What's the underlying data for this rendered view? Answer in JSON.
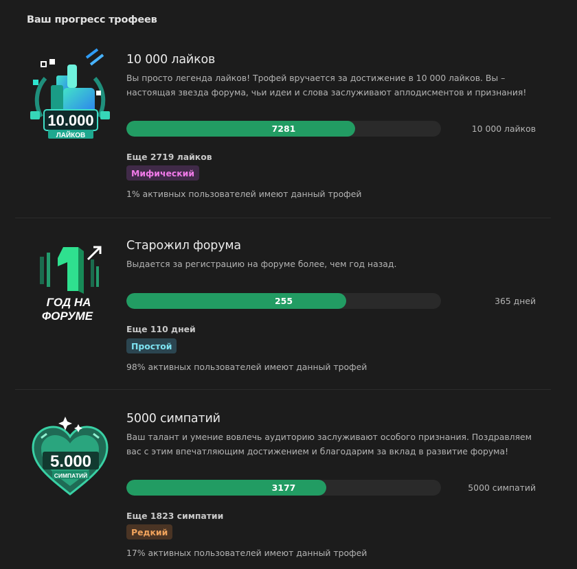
{
  "panel": {
    "title": "Ваш прогресс трофеев"
  },
  "trophies": [
    {
      "name": "10 000 лайков",
      "description": "Вы просто легенда лайков! Трофей вручается за достижение в 10 000 лайков. Вы – настоящая звезда форума, чьи идеи и слова заслуживают аплодисментов и признания!",
      "badge_big": "10.000",
      "badge_small": "ЛАЙКОВ",
      "icon": "thumbs-up-trophy-icon",
      "progress_value": "7281",
      "progress_fraction": 0.7281,
      "goal": "10 000 лайков",
      "remaining": "Еще 2719 лайков",
      "rarity": "Мифический",
      "share": "1% активных пользователей имеют данный трофей"
    },
    {
      "name": "Старожил форума",
      "description": "Выдается за регистрацию на форуме более, чем год назад.",
      "badge_big": "1",
      "badge_line1": "ГОД НА",
      "badge_line2": "ФОРУМЕ",
      "icon": "one-year-trophy-icon",
      "progress_value": "255",
      "progress_fraction": 0.6986,
      "goal": "365 дней",
      "remaining": "Еще 110 дней",
      "rarity": "Простой",
      "share": "98% активных пользователей имеют данный трофей"
    },
    {
      "name": "5000 симпатий",
      "description": "Ваш талант и умение вовлечь аудиторию заслуживают особого признания. Поздравляем вас с этим впечатляющим достижением и благодарим за вклад в развитие форума!",
      "badge_big": "5.000",
      "badge_small": "СИМПАТИЙ",
      "icon": "heart-trophy-icon",
      "progress_value": "3177",
      "progress_fraction": 0.6354,
      "goal": "5000 симпатий",
      "remaining": "Еще 1823 симпатии",
      "rarity": "Редкий",
      "share": "17% активных пользователей имеют данный трофей"
    }
  ],
  "colors": {
    "background": "#1c1c1c",
    "progress_fill": "#229c63",
    "progress_track": "#2a2a2a",
    "rarity_mythic": "#f07ae8",
    "rarity_common": "#7ee3f2",
    "rarity_rare": "#f0a35c"
  }
}
